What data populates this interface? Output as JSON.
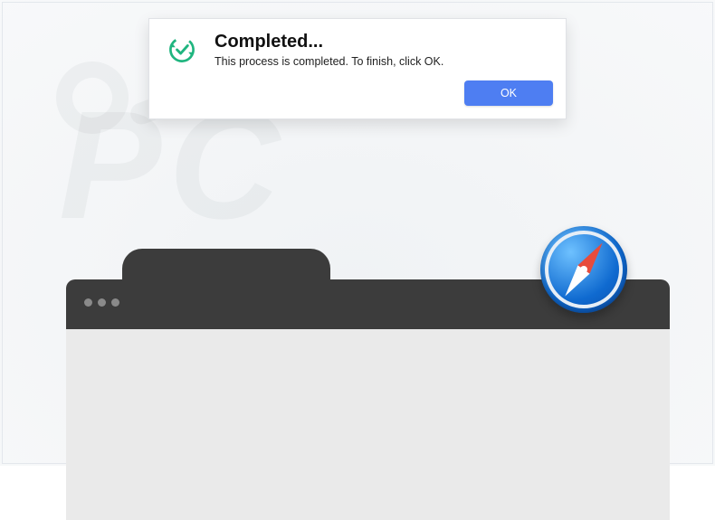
{
  "dialog": {
    "title": "Completed...",
    "message": "This process is completed. To finish, click OK.",
    "ok_label": "OK"
  },
  "icons": {
    "refresh_check": "refresh-check-icon",
    "safari": "safari-compass-icon"
  },
  "colors": {
    "accent_green": "#1fb57f",
    "button_blue": "#4e7ef2"
  }
}
